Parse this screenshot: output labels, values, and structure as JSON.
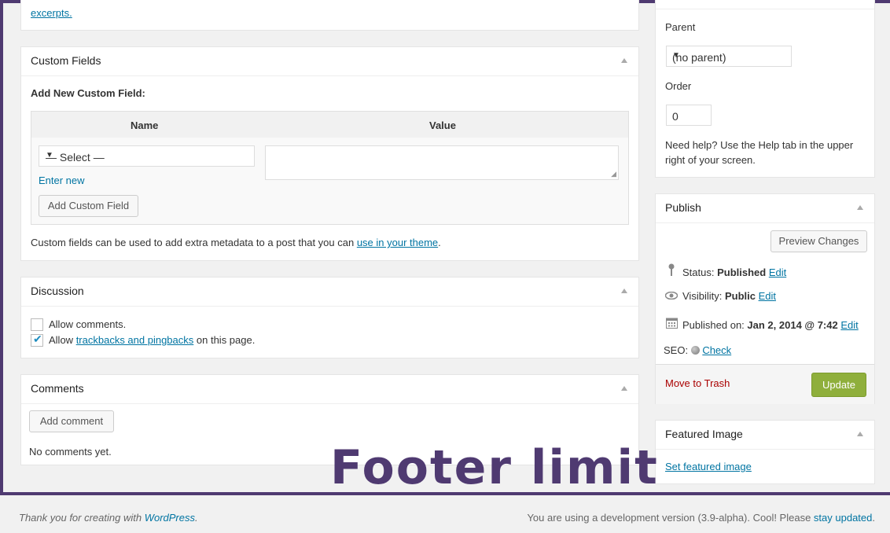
{
  "excerpt": {
    "link_text": "excerpts."
  },
  "custom_fields": {
    "title": "Custom Fields",
    "add_label": "Add New Custom Field:",
    "col_name": "Name",
    "col_value": "Value",
    "select_value": "— Select —",
    "enter_new": "Enter new",
    "add_button": "Add Custom Field",
    "note_prefix": "Custom fields can be used to add extra metadata to a post that you can ",
    "note_link": "use in your theme",
    "note_suffix": "."
  },
  "discussion": {
    "title": "Discussion",
    "allow_comments": {
      "label": "Allow comments.",
      "checked": false
    },
    "allow_pings": {
      "prefix": "Allow ",
      "link": "trackbacks and pingbacks",
      "suffix": " on this page.",
      "checked": true
    }
  },
  "comments": {
    "title": "Comments",
    "add_button": "Add comment",
    "empty_text": "No comments yet."
  },
  "attributes": {
    "parent_label": "Parent",
    "parent_value": "(no parent)",
    "order_label": "Order",
    "order_value": "0",
    "help": "Need help? Use the Help tab in the upper right of your screen."
  },
  "publish": {
    "title": "Publish",
    "preview_button": "Preview Changes",
    "status_label": "Status: ",
    "status_value": "Published",
    "visibility_label": "Visibility: ",
    "visibility_value": "Public",
    "published_label": "Published on: ",
    "published_value": "Jan 2, 2014 @ 7:42",
    "edit_link": "Edit",
    "seo_label": "SEO: ",
    "seo_link": "Check",
    "trash_link": "Move to Trash",
    "update_button": "Update"
  },
  "featured_image": {
    "title": "Featured Image",
    "set_link": "Set featured image"
  },
  "overlay_text": "Footer limit",
  "footer": {
    "left_prefix": "Thank you for creating with ",
    "left_link": "WordPress",
    "left_suffix": ".",
    "right_prefix": "You are using a development version (3.9-alpha). Cool! Please ",
    "right_link": "stay updated",
    "right_suffix": "."
  },
  "colors": {
    "frame": "#4f3a71",
    "link": "#0074a2",
    "update_button": "#8faf3c",
    "trash": "#aa0000"
  }
}
